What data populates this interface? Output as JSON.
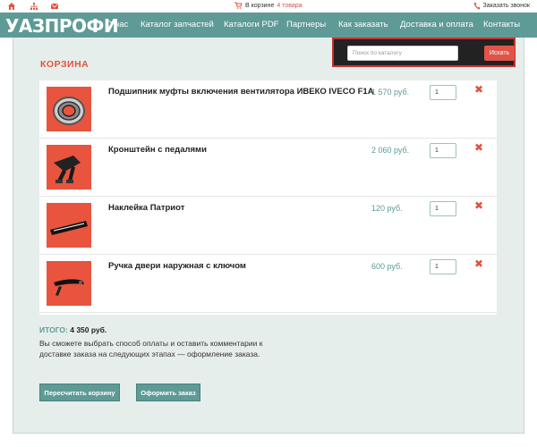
{
  "topbar": {
    "cart_prefix": "В корзине",
    "cart_count": "4 товара",
    "callback": "Заказать звонок",
    "icons": [
      "home-icon",
      "sitemap-icon",
      "mail-icon",
      "cart-icon",
      "phone-icon"
    ]
  },
  "logo": "УАЗПРОФИ",
  "nav": {
    "items": [
      {
        "label": "О нас"
      },
      {
        "label": "Каталог запчастей"
      },
      {
        "label": "Каталоги PDF"
      },
      {
        "label": "Партнеры"
      },
      {
        "label": "Как заказать"
      },
      {
        "label": "Доставка и оплата"
      },
      {
        "label": "Контакты"
      }
    ]
  },
  "search": {
    "placeholder": "Поиск по каталогу",
    "button": "Искать"
  },
  "cart": {
    "title": "КОРЗИНА",
    "items": [
      {
        "name": "Подшипник муфты включения вентилятора ИВЕКО IVECO F1A",
        "price": "1 570 руб.",
        "qty": "1",
        "image": "bearing"
      },
      {
        "name": "Кронштейн с педалями",
        "price": "2 060 руб.",
        "qty": "1",
        "image": "pedal-bracket"
      },
      {
        "name": "Наклейка Патриот",
        "price": "120 руб.",
        "qty": "1",
        "image": "patriot-sticker"
      },
      {
        "name": "Ручка двери наружная с ключом",
        "price": "600 руб.",
        "qty": "1",
        "image": "door-handle"
      }
    ],
    "total_label": "ИТОГО:",
    "total_value": "4 350 руб.",
    "note": "Вы сможете выбрать способ оплаты и оставить комментарии к доставке заказа на следующих этапах — оформление заказа.",
    "recalc_button": "Пересчитать корзину",
    "order_button": "Оформить заказ"
  },
  "colors": {
    "brand": "#5e9a96",
    "accent": "#e0533f",
    "background": "#e6eeec"
  }
}
